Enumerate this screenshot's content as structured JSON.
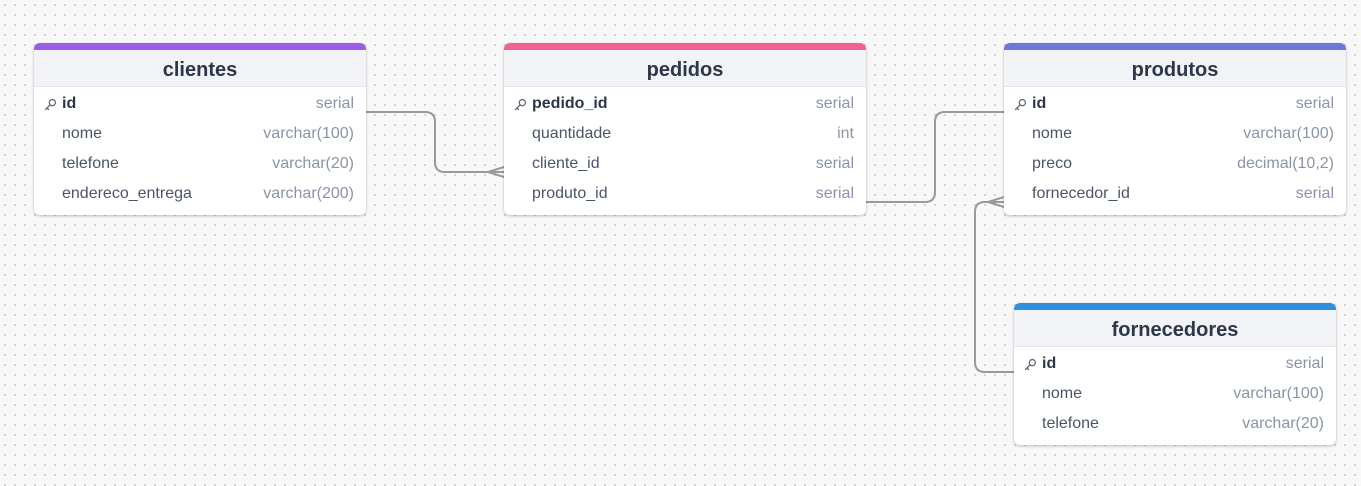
{
  "colors": {
    "clientes_accent": "#9b5de5",
    "pedidos_accent": "#f06292",
    "produtos_accent": "#6b78d6",
    "fornecedores_accent": "#2f8fdd",
    "connector": "#9a9a9a"
  },
  "tables": [
    {
      "id": "clientes",
      "title": "clientes",
      "accent": "#9b5de5",
      "columns": [
        {
          "name": "id",
          "type": "serial",
          "pk": true,
          "icon": "key-icon"
        },
        {
          "name": "nome",
          "type": "varchar(100)",
          "pk": false
        },
        {
          "name": "telefone",
          "type": "varchar(20)",
          "pk": false
        },
        {
          "name": "endereco_entrega",
          "type": "varchar(200)",
          "pk": false
        }
      ]
    },
    {
      "id": "pedidos",
      "title": "pedidos",
      "accent": "#f06292",
      "columns": [
        {
          "name": "pedido_id",
          "type": "serial",
          "pk": true,
          "icon": "key-icon"
        },
        {
          "name": "quantidade",
          "type": "int",
          "pk": false
        },
        {
          "name": "cliente_id",
          "type": "serial",
          "pk": false
        },
        {
          "name": "produto_id",
          "type": "serial",
          "pk": false
        }
      ]
    },
    {
      "id": "produtos",
      "title": "produtos",
      "accent": "#6b78d6",
      "columns": [
        {
          "name": "id",
          "type": "serial",
          "pk": true,
          "icon": "key-icon"
        },
        {
          "name": "nome",
          "type": "varchar(100)",
          "pk": false
        },
        {
          "name": "preco",
          "type": "decimal(10,2)",
          "pk": false
        },
        {
          "name": "fornecedor_id",
          "type": "serial",
          "pk": false
        }
      ]
    },
    {
      "id": "fornecedores",
      "title": "fornecedores",
      "accent": "#2f8fdd",
      "columns": [
        {
          "name": "id",
          "type": "serial",
          "pk": true,
          "icon": "key-icon"
        },
        {
          "name": "nome",
          "type": "varchar(100)",
          "pk": false
        },
        {
          "name": "telefone",
          "type": "varchar(20)",
          "pk": false
        }
      ]
    }
  ],
  "relationships": [
    {
      "from_table": "clientes",
      "from_column": "id",
      "from_end": "one",
      "to_table": "pedidos",
      "to_column": "cliente_id",
      "to_end": "many"
    },
    {
      "from_table": "pedidos",
      "from_column": "produto_id",
      "from_end": "one",
      "to_table": "produtos",
      "to_column": "id",
      "to_end": "one"
    },
    {
      "from_table": "fornecedores",
      "from_column": "id",
      "from_end": "one",
      "to_table": "produtos",
      "to_column": "fornecedor_id",
      "to_end": "many"
    }
  ]
}
